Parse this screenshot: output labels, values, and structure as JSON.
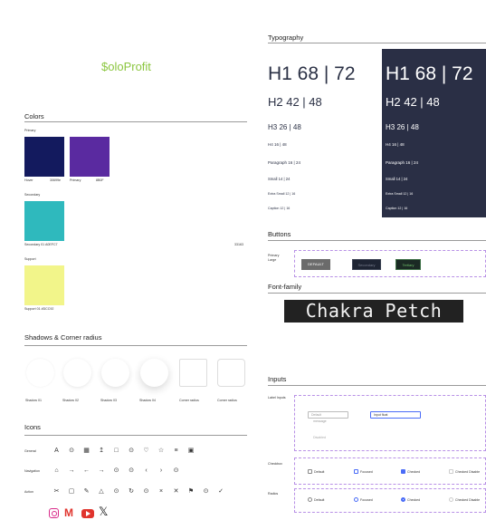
{
  "brand": {
    "name": "$oloProfit",
    "color": "#8bc63f"
  },
  "colors": {
    "title": "Colors",
    "primary_label": "Primary",
    "hover_label": "Hover",
    "hover_hex": "30699e",
    "primary_name": "Primary",
    "primary_hex": "8B0F",
    "secondary_label": "Secondary",
    "secondary_caption": "Secondary 01  A0EFC7",
    "secondary_right": "33163",
    "support_label": "Support",
    "support_caption": "Support 01  #DCC92",
    "swatch_hover": "#131a5e",
    "swatch_primary": "#5a2aa0",
    "swatch_secondary": "#2fb9bd",
    "swatch_support": "#f2f58a"
  },
  "shadows": {
    "title": "Shadows & Corner radius",
    "items": [
      "Shadow 01",
      "Shadow 02",
      "Shadow 03",
      "Shadow 04",
      "Corner radius",
      "Corner radius"
    ]
  },
  "icons": {
    "title": "Icons",
    "rows": [
      {
        "label": "General",
        "glyphs": [
          "A",
          "⊙",
          "▦",
          "↥",
          "□",
          "⊙",
          "♡",
          "☆",
          "≡",
          "▣"
        ]
      },
      {
        "label": "Navigation",
        "glyphs": [
          "⌂",
          "→",
          "←",
          "→",
          "⊙",
          "⊙",
          "‹",
          "›",
          "⊙"
        ]
      },
      {
        "label": "Action",
        "glyphs": [
          "✂",
          "▢",
          "✎",
          "△",
          "⊙",
          "↻",
          "⊙",
          "×",
          "✕",
          "⚑",
          "⊙",
          "✓"
        ]
      }
    ],
    "social": [
      "instagram-icon",
      "gmail-icon",
      "youtube-icon",
      "x-icon"
    ]
  },
  "typography": {
    "title": "Typography",
    "h1": "H1 68 | 72",
    "h2": "H2 42 | 48",
    "h3": "H3 26 | 48",
    "h4": "H4 16 | 48",
    "paragraph": "Paragraph 16 | 24",
    "small": "Small 14 | 24",
    "extra_small": "Extra Small 12 | 16",
    "caption": "Caption 12 | 16",
    "dark_bg": "#2a2f45"
  },
  "buttons": {
    "title": "Buttons",
    "row_label": "Primary Large",
    "default": "DEFAULT",
    "secondary": "Secondary",
    "tertiary": "Tertiary"
  },
  "font_family": {
    "title": "Font-family",
    "sample": "Chakra Petch"
  },
  "inputs": {
    "title": "Inputs",
    "label_inputs": "Label Inputs",
    "default_placeholder": "Default",
    "message": "message",
    "input_float": "Input float",
    "disabled": "Disabled",
    "checkbox_label": "Checkbox",
    "radios_label": "Radios",
    "options": [
      "Default",
      "Focused",
      "Checked",
      "Checked Disable"
    ]
  }
}
